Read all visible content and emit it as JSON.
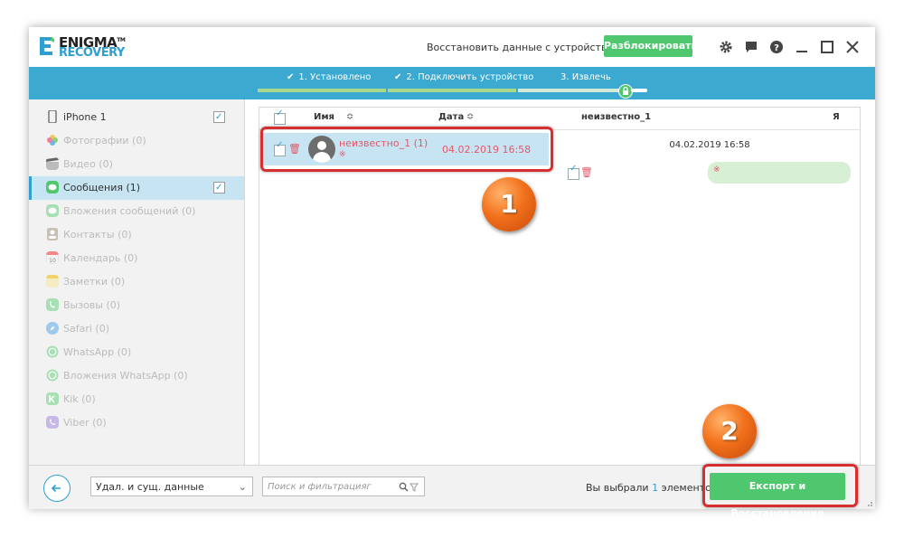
{
  "header": {
    "logo_line1": "ENIGMA",
    "logo_tm": "TM",
    "logo_line2": "RECOVERY",
    "restore_link": "Восстановить данные с устройства",
    "unlock_button": "Разблокировать",
    "icons": [
      "gear-icon",
      "chat-icon",
      "help-icon",
      "minimize-icon",
      "maximize-icon",
      "close-icon"
    ]
  },
  "steps": [
    {
      "label": "1. Установлено",
      "done": true
    },
    {
      "label": "2. Подключить устройство",
      "done": true
    },
    {
      "label": "3. Извлечь",
      "done": false
    }
  ],
  "sidebar": {
    "items": [
      {
        "label": "iPhone 1",
        "icon": "iphone-icon",
        "checked": true
      },
      {
        "label": "Фотографии (0)",
        "icon": "photos-icon"
      },
      {
        "label": "Видео (0)",
        "icon": "video-icon"
      },
      {
        "label": "Сообщения (1)",
        "icon": "messages-icon",
        "checked": true,
        "active": true
      },
      {
        "label": "Вложения сообщений (0)",
        "icon": "attachments-icon"
      },
      {
        "label": "Контакты (0)",
        "icon": "contacts-icon"
      },
      {
        "label": "Календарь (0)",
        "icon": "calendar-icon"
      },
      {
        "label": "Заметки (0)",
        "icon": "notes-icon"
      },
      {
        "label": "Вызовы (0)",
        "icon": "phone-icon"
      },
      {
        "label": "Safari (0)",
        "icon": "safari-icon"
      },
      {
        "label": "WhatsApp (0)",
        "icon": "whatsapp-icon"
      },
      {
        "label": "Вложения WhatsApp (0)",
        "icon": "whatsapp-attachments-icon"
      },
      {
        "label": "Kik (0)",
        "icon": "kik-icon"
      },
      {
        "label": "Viber (0)",
        "icon": "viber-icon"
      }
    ],
    "calendar_day": "10"
  },
  "list": {
    "col_name": "Имя",
    "col_date": "Дата",
    "rows": [
      {
        "name": "неизвестно_1 (1)",
        "date": "04.02.2019 16:58",
        "preview": "※"
      }
    ]
  },
  "detail": {
    "contact": "неизвестно_1",
    "me_label": "Я",
    "timestamp": "04.02.2019 16:58",
    "bubble_text": "※"
  },
  "footer": {
    "filter_value": "Удал. и сущ. данные",
    "search_placeholder": "Поиск и фильтрацияг",
    "selected_prefix": "Вы выбрали",
    "selected_count": "1",
    "selected_suffix": "элементов",
    "export_button": "Експорт и Восстановление"
  },
  "annotations": {
    "callout_1": "1",
    "callout_2": "2"
  },
  "colors": {
    "accent_blue": "#3ba9d0",
    "green": "#4fc76f",
    "highlight": "#c6e4f2",
    "red_text": "#e15a6b",
    "callout_border": "#d62f2f",
    "callout_orange": "#f2711c"
  }
}
